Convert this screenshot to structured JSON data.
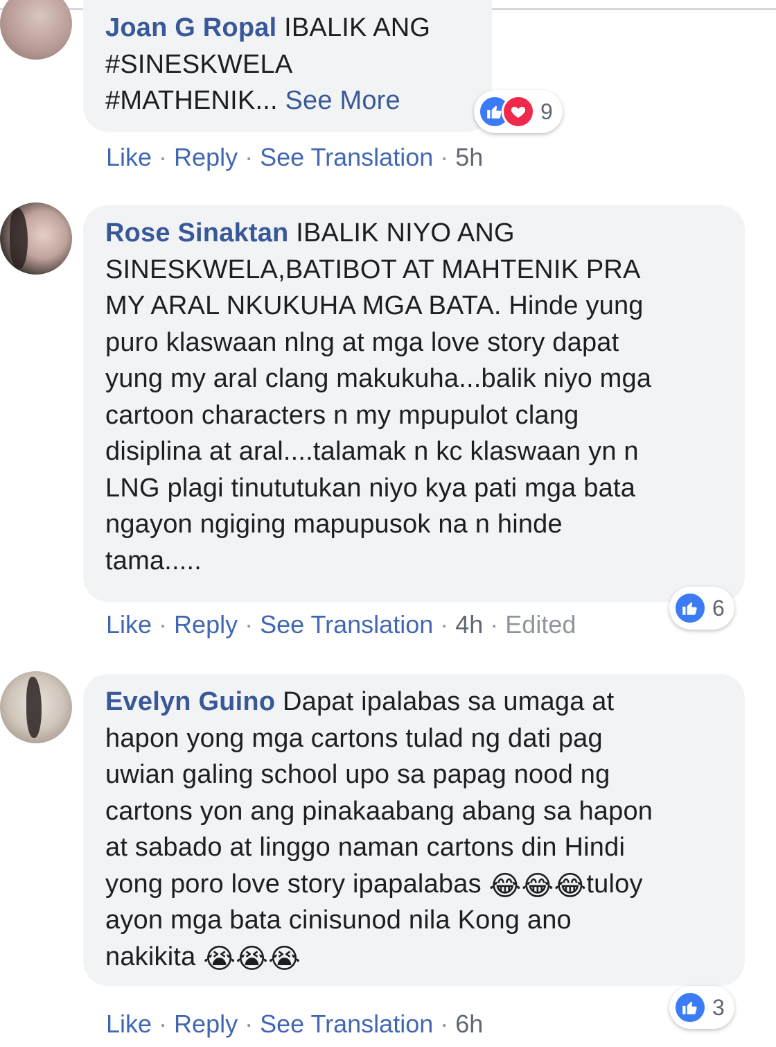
{
  "comments": [
    {
      "author": "Joan G Ropal",
      "lines": [
        "IBALIK ANG",
        "#SINESKWELA",
        "#MATHENIK..."
      ],
      "see_more": "See More",
      "reactions": {
        "icons": [
          "like-icon",
          "love-icon"
        ],
        "count": "9"
      },
      "actions": {
        "like": "Like",
        "reply": "Reply",
        "translate": "See Translation",
        "time": "5h"
      }
    },
    {
      "author": "Rose Sinaktan",
      "lines": [
        "IBALIK NIYO ANG",
        "SINESKWELA,BATIBOT AT MAHTENIK PRA",
        "MY ARAL NKUKUHA MGA BATA. Hinde yung",
        "puro klaswaan nlng at mga love story dapat",
        "yung my aral clang makukuha...balik niyo mga",
        "cartoon characters n my mpupulot clang",
        "disiplina at aral....talamak n kc klaswaan yn n",
        "LNG plagi tinututukan niyo kya pati mga bata",
        "ngayon ngiging mapupusok na n hinde",
        "tama....."
      ],
      "reactions": {
        "icons": [
          "like-icon"
        ],
        "count": "6"
      },
      "actions": {
        "like": "Like",
        "reply": "Reply",
        "translate": "See Translation",
        "time": "4h",
        "edited": "Edited"
      }
    },
    {
      "author": "Evelyn Guino",
      "lines": [
        "Dapat ipalabas sa umaga at",
        "hapon yong mga cartons tulad ng dati pag",
        "uwian galing school upo sa papag nood ng",
        "cartons yon ang pinakaabang abang sa hapon",
        "at sabado at linggo naman cartons din Hindi",
        "yong poro love story ipapalabas",
        "tuloy",
        "ayon mga bata cinisunod nila Kong ano",
        "nakikita"
      ],
      "emoji": {
        "laugh": "😂",
        "cry": "😭"
      },
      "reactions": {
        "icons": [
          "like-icon"
        ],
        "count": "3"
      },
      "actions": {
        "like": "Like",
        "reply": "Reply",
        "translate": "See Translation",
        "time": "6h"
      }
    }
  ],
  "separator": "·"
}
